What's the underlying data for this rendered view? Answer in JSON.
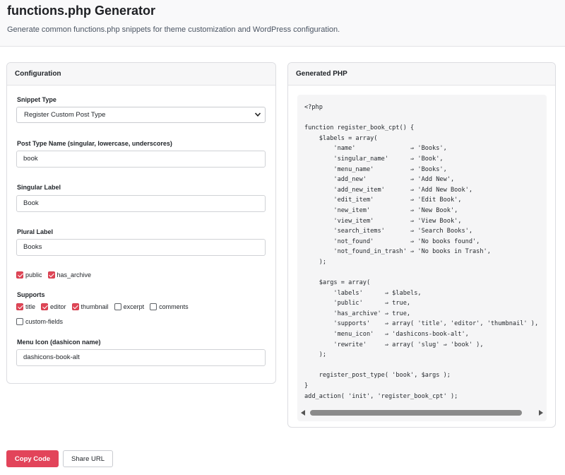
{
  "header": {
    "title": "functions.php Generator",
    "subtitle": "Generate common functions.php snippets for theme customization and WordPress configuration."
  },
  "config": {
    "panel_title": "Configuration",
    "snippet_type": {
      "label": "Snippet Type",
      "value": "Register Custom Post Type"
    },
    "post_type_name": {
      "label": "Post Type Name (singular, lowercase, underscores)",
      "value": "book"
    },
    "singular_label": {
      "label": "Singular Label",
      "value": "Book"
    },
    "plural_label": {
      "label": "Plural Label",
      "value": "Books"
    },
    "flags": [
      {
        "label": "public",
        "checked": true
      },
      {
        "label": "has_archive",
        "checked": true
      }
    ],
    "supports": {
      "label": "Supports",
      "items": [
        {
          "label": "title",
          "checked": true
        },
        {
          "label": "editor",
          "checked": true
        },
        {
          "label": "thumbnail",
          "checked": true
        },
        {
          "label": "excerpt",
          "checked": false
        },
        {
          "label": "comments",
          "checked": false
        },
        {
          "label": "custom-fields",
          "checked": false
        }
      ]
    },
    "menu_icon": {
      "label": "Menu Icon (dashicon name)",
      "value": "dashicons-book-alt"
    }
  },
  "output": {
    "panel_title": "Generated PHP",
    "code": "<?php\n\nfunction register_book_cpt() {\n    $labels = array(\n        'name'               ⇒ 'Books',\n        'singular_name'      ⇒ 'Book',\n        'menu_name'          ⇒ 'Books',\n        'add_new'            ⇒ 'Add New',\n        'add_new_item'       ⇒ 'Add New Book',\n        'edit_item'          ⇒ 'Edit Book',\n        'new_item'           ⇒ 'New Book',\n        'view_item'          ⇒ 'View Book',\n        'search_items'       ⇒ 'Search Books',\n        'not_found'          ⇒ 'No books found',\n        'not_found_in_trash' ⇒ 'No books in Trash',\n    );\n\n    $args = array(\n        'labels'      ⇒ $labels,\n        'public'      ⇒ true,\n        'has_archive' ⇒ true,\n        'supports'    ⇒ array( 'title', 'editor', 'thumbnail' ),\n        'menu_icon'   ⇒ 'dashicons-book-alt',\n        'rewrite'     ⇒ array( 'slug' ⇒ 'book' ),\n    );\n\n    register_post_type( 'book', $args );\n}\nadd_action( 'init', 'register_book_cpt' );"
  },
  "actions": {
    "copy_label": "Copy Code",
    "share_label": "Share URL"
  },
  "colors": {
    "accent": "#e2445a",
    "code_bg": "#f5f5f6"
  }
}
